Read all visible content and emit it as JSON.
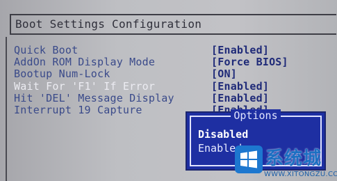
{
  "header": {
    "title": "Boot Settings Configuration"
  },
  "settings": [
    {
      "label": "Quick Boot",
      "value": "[Enabled]"
    },
    {
      "label": "AddOn ROM Display Mode",
      "value": "[Force BIOS]"
    },
    {
      "label": "Bootup Num-Lock",
      "value": "[ON]"
    },
    {
      "label": "Wait For 'F1' If Error",
      "value": "[Enabled]"
    },
    {
      "label": "Hit 'DEL' Message Display",
      "value": "[Enabled]"
    },
    {
      "label": "Interrupt 19 Capture",
      "value": "[Enabled]"
    }
  ],
  "options_popup": {
    "title": "Options",
    "items": [
      "Disabled",
      "Enabled"
    ],
    "selected": "Disabled"
  },
  "watermark": {
    "text": "系统城",
    "url": "WWW.XITONGZU.COM"
  },
  "colors": {
    "screen_bg": "#bebfc3",
    "label": "#3a4a8a",
    "active_label": "#ececf2",
    "value": "#1f2a78",
    "popup_bg": "#1e2fa2"
  }
}
